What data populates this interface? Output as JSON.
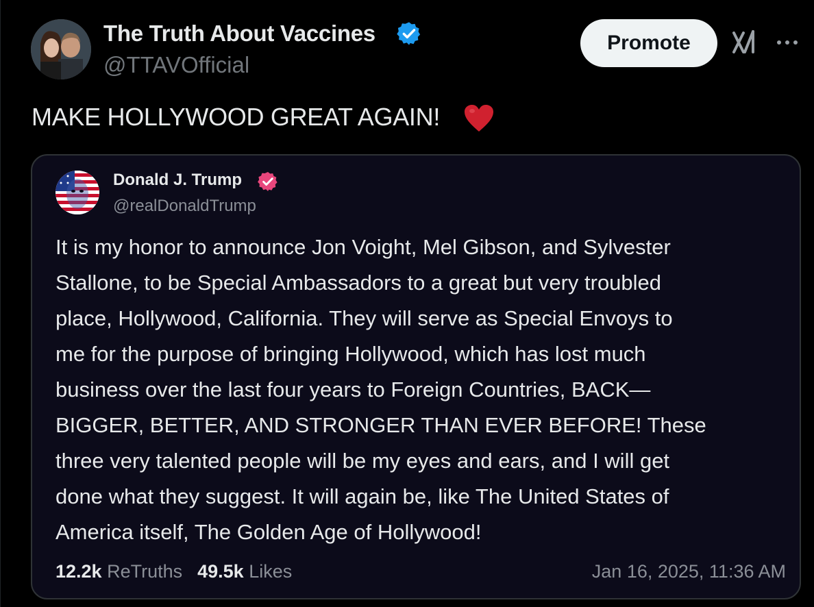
{
  "post": {
    "author_name": "The Truth About Vaccines",
    "author_handle": "@TTAVOfficial",
    "promote_label": "Promote",
    "text": "MAKE HOLLYWOOD GREAT AGAIN!",
    "emoji": "red-heart-icon",
    "verified_color": "#1d9bf0"
  },
  "quote": {
    "author_name": "Donald J. Trump",
    "author_handle": "@realDonaldTrump",
    "verified_color": "#e0245e",
    "body_lines": [
      "It is my honor to announce Jon Voight, Mel Gibson, and Sylvester",
      "Stallone, to be Special Ambassadors to a great but very troubled",
      "place, Hollywood, California. They will serve as Special Envoys to",
      "me for the purpose of bringing Hollywood, which has lost much",
      "business over the last four years to Foreign Countries, BACK—",
      "BIGGER, BETTER, AND STRONGER THAN EVER BEFORE! These",
      "three very talented people will be my eyes and ears, and I will get",
      "done what they suggest. It will again be, like The United States of",
      "America itself, The Golden Age of Hollywood!"
    ],
    "retruths_count": "12.2k",
    "retruths_label": "ReTruths",
    "likes_count": "49.5k",
    "likes_label": "Likes",
    "timestamp": "Jan 16, 2025, 11:36 AM"
  }
}
